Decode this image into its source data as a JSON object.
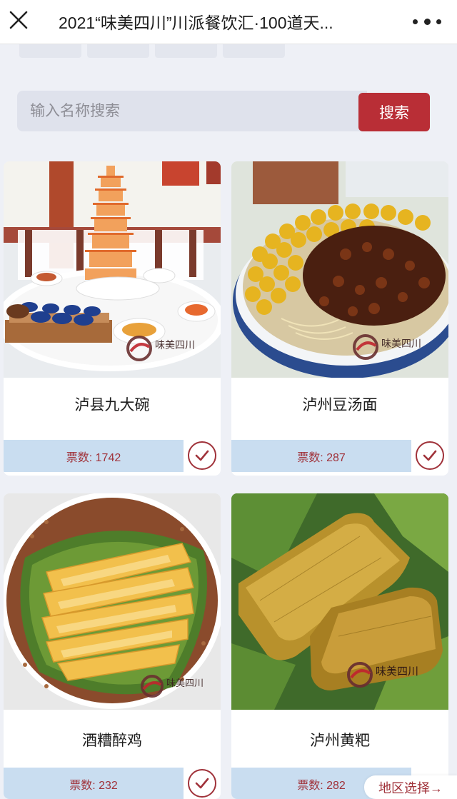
{
  "header": {
    "title": "2021“味美四川”川派餐饮汇·100道天...",
    "close_icon": "close-icon",
    "more_icon": "more-icon"
  },
  "search": {
    "placeholder": "输入名称搜索",
    "button_label": "搜索"
  },
  "dishes": [
    {
      "name": "泸县九大碗",
      "votes": "票数: 1742",
      "vote_icon": "check-circle-icon"
    },
    {
      "name": "泸州豆汤面",
      "votes": "票数: 287",
      "vote_icon": "check-circle-icon"
    },
    {
      "name": "酒糟醉鸡",
      "votes": "票数: 232",
      "vote_icon": "check-circle-icon"
    },
    {
      "name": "泸州黄粑",
      "votes": "票数: 282",
      "vote_icon": "check-circle-icon"
    }
  ],
  "region_button": "地区选择→",
  "colors": {
    "accent": "#b92e36",
    "vote_text": "#a0323a",
    "vote_bar": "#c9ddf0",
    "page_bg": "#eef0f6"
  }
}
